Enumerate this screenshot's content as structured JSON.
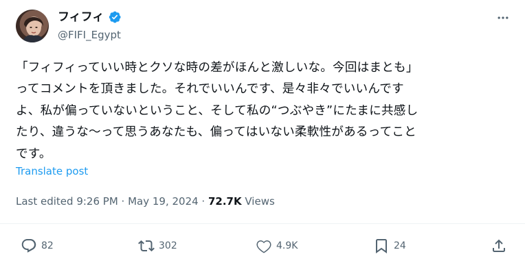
{
  "author": {
    "name": "フィフィ",
    "handle": "@FIFI_Egypt",
    "avatar_icon": "profile-photo-avatar",
    "verified_icon": "verified-badge-icon",
    "verified_color": "#1d9bf0"
  },
  "tweet": {
    "text": "「フィフィっていい時とクソな時の差がほんと激しいな。今回はまとも」\nってコメントを頂きました。それでいいんです、是々非々でいいんです\nよ、私が偏っていないということ、そして私の“つぶやき”にたまに共感し\nたり、違うな〜って思うあなたも、偏ってはいない柔軟性があるってこと\nです。",
    "translate_label": "Translate post"
  },
  "meta": {
    "edited": "Last edited 9:26 PM · May 19, 2024 · ",
    "views_count": "72.7K",
    "views_label": " Views"
  },
  "actions": {
    "replies": "82",
    "reposts": "302",
    "likes": "4.9K",
    "bookmarks": "24"
  },
  "colors": {
    "text": "#0f1419",
    "muted": "#536471",
    "link": "#1d9bf0"
  }
}
